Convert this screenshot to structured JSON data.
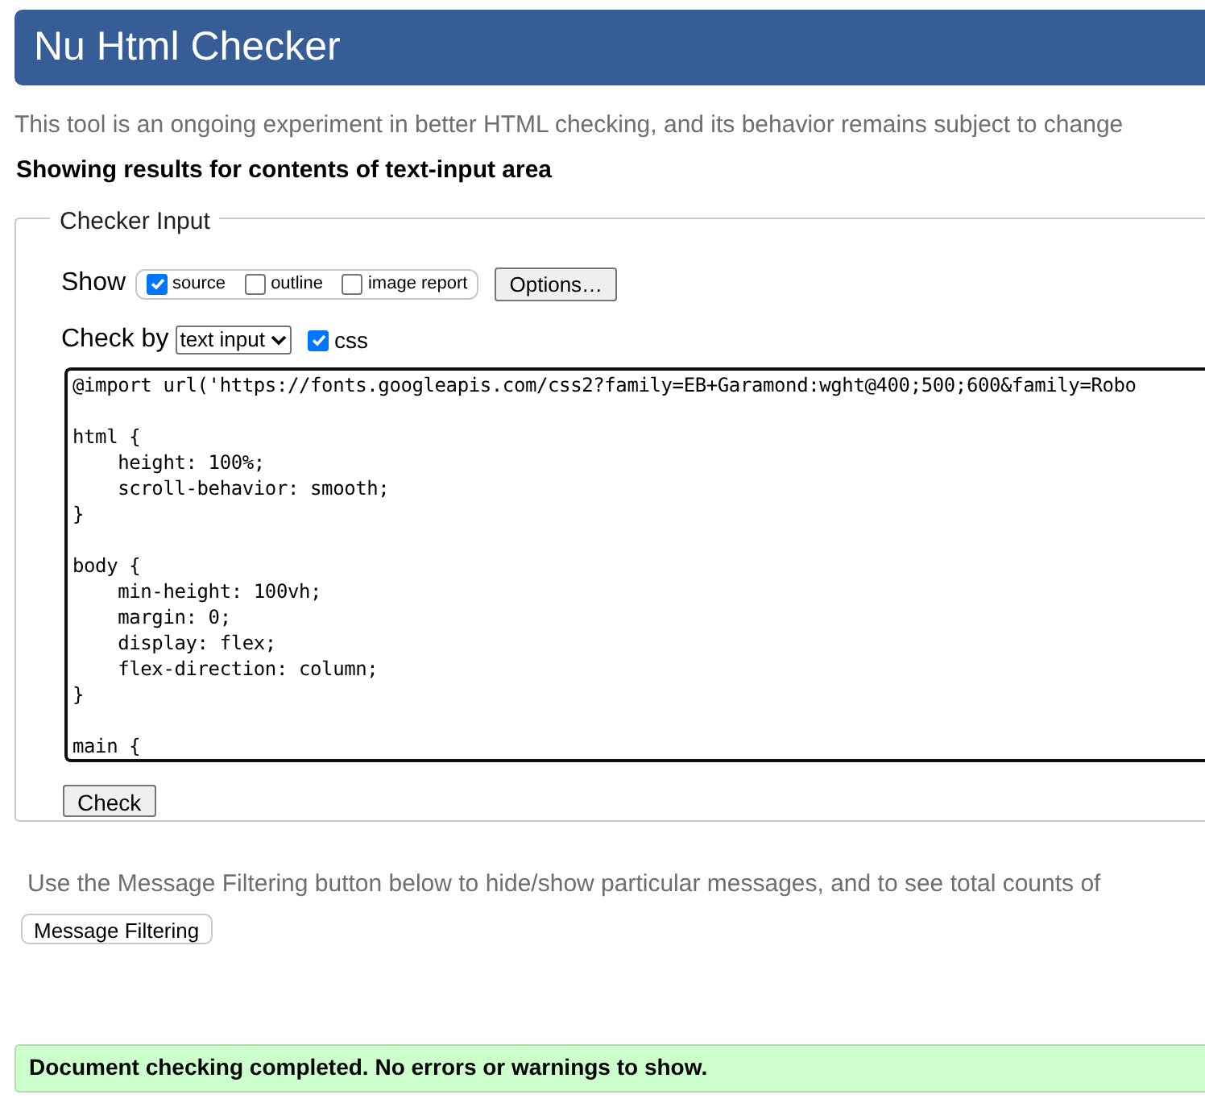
{
  "header": {
    "title": "Nu Html Checker"
  },
  "intro": "This tool is an ongoing experiment in better HTML checking, and its behavior remains subject to change",
  "results_heading": "Showing results for contents of text-input area",
  "checker_input": {
    "legend": "Checker Input",
    "show_label": "Show",
    "show_options": [
      {
        "label": "source",
        "checked": true
      },
      {
        "label": "outline",
        "checked": false
      },
      {
        "label": "image report",
        "checked": false
      }
    ],
    "options_button": "Options…",
    "check_by_label": "Check by",
    "check_by_value": "text input",
    "css": {
      "label": "css",
      "checked": true
    },
    "code_blocks": [
      [
        "@import url('https://fonts.googleapis.com/css2?family=EB+Garamond:wght@400;500;600&family=Robo"
      ],
      [
        "html {",
        "    height: 100%;",
        "    scroll-behavior: smooth;",
        "}"
      ],
      [
        "body {",
        "    min-height: 100vh;",
        "    margin: 0;",
        "    display: flex;",
        "    flex-direction: column;",
        "}"
      ],
      [
        "main {"
      ]
    ],
    "check_button": "Check"
  },
  "filter_note": "Use the Message Filtering button below to hide/show particular messages, and to see total counts of",
  "filter_button": "Message Filtering",
  "status": "Document checking completed. No errors or warnings to show."
}
